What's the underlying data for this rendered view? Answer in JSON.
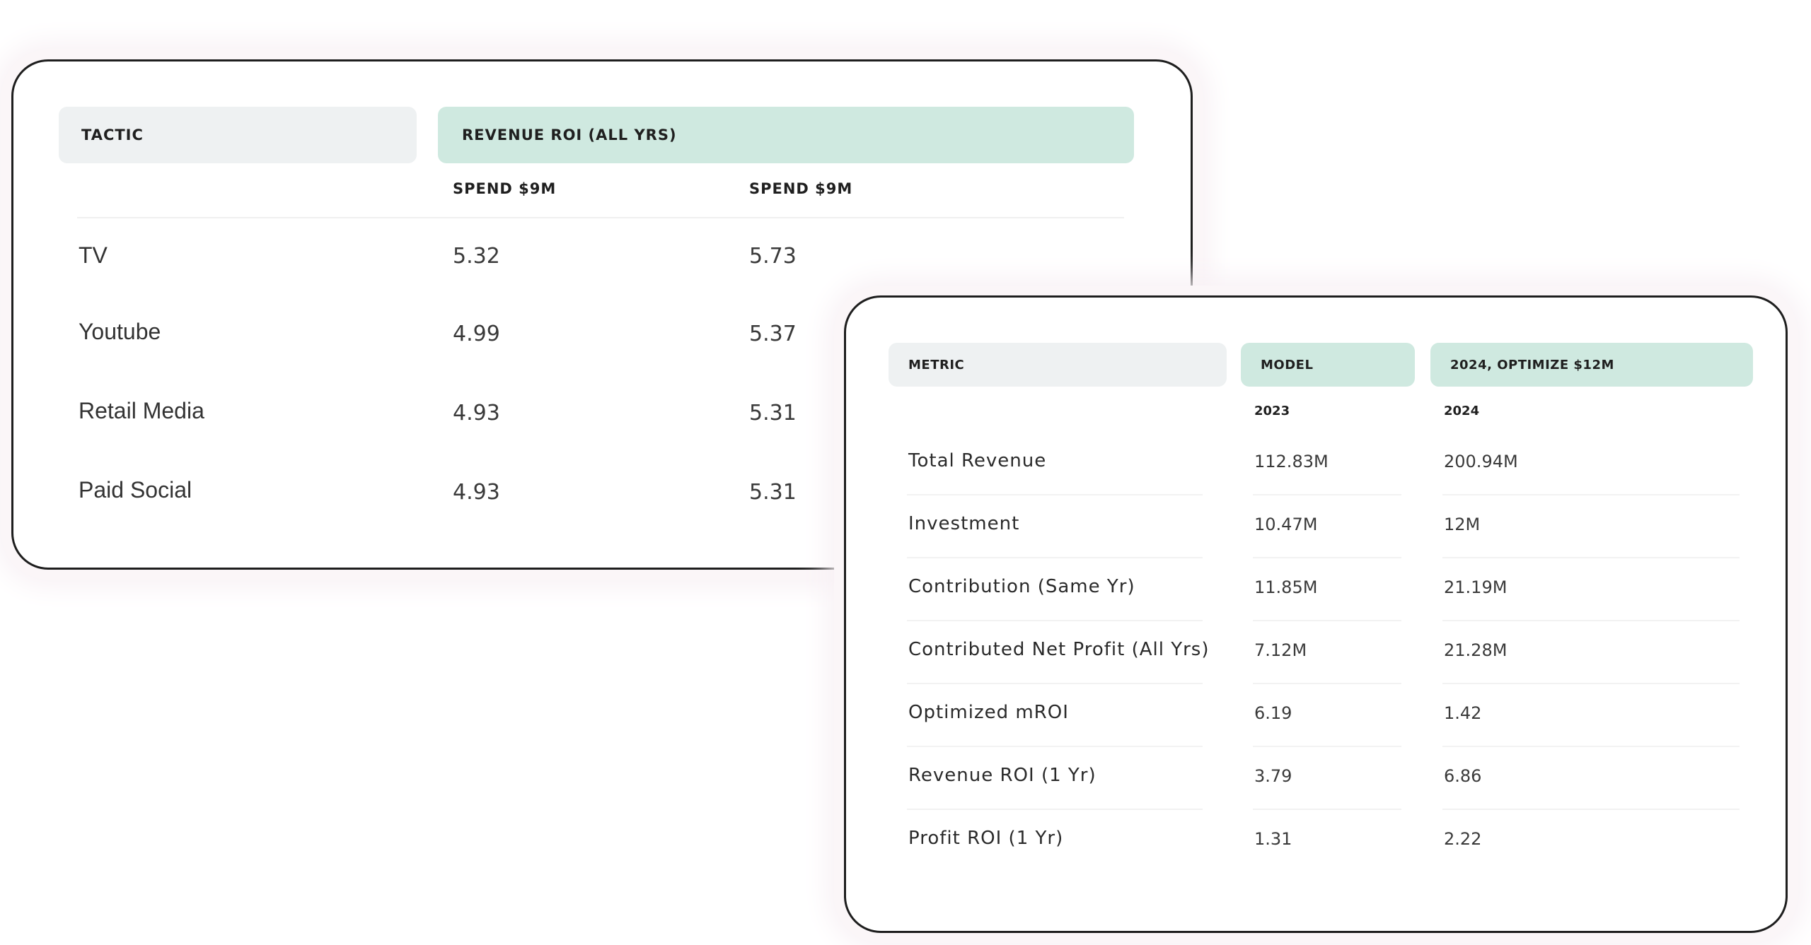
{
  "tactic_table": {
    "header_tactic": "TACTIC",
    "header_roi": "REVENUE ROI (ALL YRS)",
    "sub_col_1": "SPEND $9M",
    "sub_col_2": "SPEND $9M",
    "rows": [
      {
        "name": "TV",
        "v1": "5.32",
        "v2": "5.73"
      },
      {
        "name": "Youtube",
        "v1": "4.99",
        "v2": "5.37"
      },
      {
        "name": "Retail Media",
        "v1": "4.93",
        "v2": "5.31"
      },
      {
        "name": "Paid Social",
        "v1": "4.93",
        "v2": "5.31"
      }
    ]
  },
  "metric_table": {
    "header_metric": "METRIC",
    "header_model": "MODEL",
    "header_optimize": "2024, OPTIMIZE $12M",
    "sub_col_1": "2023",
    "sub_col_2": "2024",
    "rows": [
      {
        "name": "Total Revenue",
        "v1": "112.83M",
        "v2": "200.94M"
      },
      {
        "name": "Investment",
        "v1": "10.47M",
        "v2": "12M"
      },
      {
        "name": "Contribution (Same Yr)",
        "v1": "11.85M",
        "v2": "21.19M"
      },
      {
        "name": "Contributed Net Profit (All Yrs)",
        "v1": "7.12M",
        "v2": "21.28M"
      },
      {
        "name": "Optimized mROI",
        "v1": "6.19",
        "v2": "1.42"
      },
      {
        "name": "Revenue ROI (1 Yr)",
        "v1": "3.79",
        "v2": "6.86"
      },
      {
        "name": "Profit ROI (1 Yr)",
        "v1": "1.31",
        "v2": "2.22"
      }
    ]
  },
  "colors": {
    "header_grey": "#eef1f2",
    "header_green": "#cfe9e0",
    "card_border": "#1e1e1e"
  }
}
